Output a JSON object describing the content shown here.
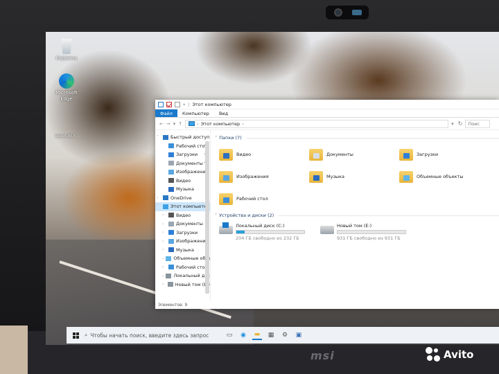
{
  "desktop": {
    "icons": [
      {
        "label": "Корзина",
        "icon": "recycle-bin-icon"
      },
      {
        "label": "Microsoft Edge",
        "icon": "edge-icon"
      }
    ],
    "partial_label": "ерол.огл"
  },
  "explorer": {
    "title": "Этот компьютер",
    "ribbon": {
      "file": "Файл",
      "computer": "Компьютер",
      "view": "Вид"
    },
    "address": {
      "path": "Этот компьютер",
      "search_placeholder": "Поис"
    },
    "nav": [
      {
        "label": "Быстрый доступ",
        "icon": "star-icon",
        "pinned": false
      },
      {
        "label": "Рабочий сто",
        "icon": "desktop-folder-icon",
        "pinned": true
      },
      {
        "label": "Загрузки",
        "icon": "download-icon",
        "pinned": true
      },
      {
        "label": "Документы",
        "icon": "documents-icon",
        "pinned": true
      },
      {
        "label": "Изображени",
        "icon": "pictures-icon",
        "pinned": true
      },
      {
        "label": "Видео",
        "icon": "video-icon",
        "pinned": false
      },
      {
        "label": "Музыка",
        "icon": "music-icon",
        "pinned": false
      },
      {
        "label": "OneDrive",
        "icon": "cloud-icon",
        "pinned": false
      },
      {
        "label": "Этот компьютер",
        "icon": "computer-icon",
        "pinned": false,
        "selected": true
      },
      {
        "label": "Видео",
        "icon": "video-icon",
        "pinned": false
      },
      {
        "label": "Документы",
        "icon": "documents-icon",
        "pinned": false
      },
      {
        "label": "Загрузки",
        "icon": "download-icon",
        "pinned": false
      },
      {
        "label": "Изображения",
        "icon": "pictures-icon",
        "pinned": false
      },
      {
        "label": "Музыка",
        "icon": "music-icon",
        "pinned": false
      },
      {
        "label": "Объемные объе",
        "icon": "3d-objects-icon",
        "pinned": false
      },
      {
        "label": "Рабочий стол",
        "icon": "desktop-folder-icon",
        "pinned": false
      },
      {
        "label": "Локальный дис",
        "icon": "drive-icon",
        "pinned": false
      },
      {
        "label": "Новый том (E:)",
        "icon": "drive-icon",
        "pinned": false
      }
    ],
    "status": "Элементов: 9",
    "folders_header": "Папки (7)",
    "folders": [
      {
        "label": "Видео",
        "badge_color": "#2f6fbf"
      },
      {
        "label": "Документы",
        "badge_color": "#d8dee6"
      },
      {
        "label": "Загрузки",
        "badge_color": "#2f7fd6"
      },
      {
        "label": "Изображения",
        "badge_color": "#5aa7e0"
      },
      {
        "label": "Музыка",
        "badge_color": "#2b6cc0"
      },
      {
        "label": "Объемные объекты",
        "badge_color": "#5fb4e8"
      },
      {
        "label": "Рабочий стол",
        "badge_color": "#3a8fd9"
      }
    ],
    "drives_header": "Устройства и диски (2)",
    "drives": [
      {
        "label": "Локальный диск (C:)",
        "free": "204 ГБ свободно из 232 ГБ",
        "used_fraction": 0.12
      },
      {
        "label": "Новый том (E:)",
        "free": "931 ГБ свободно из 931 ГБ",
        "used_fraction": 0.0
      }
    ]
  },
  "taskbar": {
    "search_placeholder": "Чтобы начать поиск, введите здесь запрос"
  },
  "brand": {
    "laptop": "msi",
    "watermark": "Avito"
  }
}
